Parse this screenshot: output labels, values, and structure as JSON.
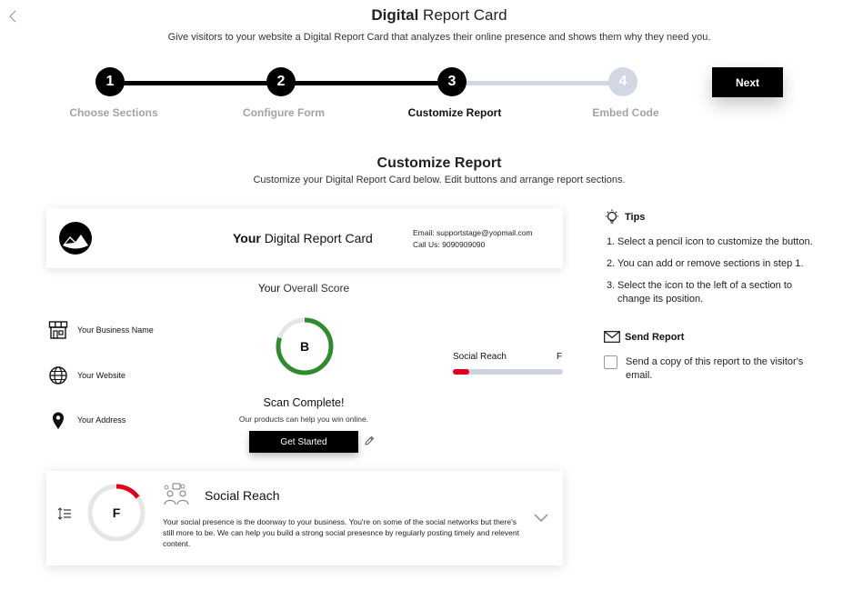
{
  "header": {
    "back_icon": "chevron-left-icon",
    "title_bold": "Digital",
    "title_rest": " Report Card",
    "subtitle": "Give visitors to your website a Digital Report Card that analyzes their online presence and shows them why they need you."
  },
  "stepper": {
    "steps": [
      {
        "number": "1",
        "label": "Choose Sections",
        "state": "done"
      },
      {
        "number": "2",
        "label": "Configure Form",
        "state": "done"
      },
      {
        "number": "3",
        "label": "Customize Report",
        "state": "active"
      },
      {
        "number": "4",
        "label": "Embed Code",
        "state": "pending"
      }
    ],
    "next_label": "Next"
  },
  "section": {
    "title": "Customize Report",
    "subtitle": "Customize your Digital Report Card below. Edit buttons and arrange report sections."
  },
  "report": {
    "title_bold": "Your",
    "title_rest": " Digital Report Card",
    "email": "Email: supportstage@yopmail.com",
    "phone": "Call Us: 9090909090",
    "overall_bold": "Your",
    "overall_rest": " Overall Score",
    "business": [
      {
        "icon": "storefront-icon",
        "label": "Your Business Name"
      },
      {
        "icon": "globe-icon",
        "label": "Your Website"
      },
      {
        "icon": "location-pin-icon",
        "label": "Your Address"
      }
    ],
    "overall_grade": "B",
    "overall_progress": 0.8,
    "scan_title": "Scan Complete!",
    "scan_sub": "Our products can help you win online.",
    "cta_label": "Get Started",
    "metric": {
      "label": "Social Reach",
      "grade": "F",
      "progress": 0.15
    }
  },
  "social_section": {
    "grade": "F",
    "progress": 0.15,
    "title": "Social Reach",
    "description": "Your social presence is the doorway to your business. You're on some of the social networks but there's still more to be. We can help you build a strong social presesnce by regularly posting timely and relevent content."
  },
  "tips": {
    "title": "Tips",
    "items": [
      {
        "num": "1.",
        "text": "Select a pencil icon to customize the button."
      },
      {
        "num": "2.",
        "text": "You can add or remove sections in step 1."
      },
      {
        "num": "3.",
        "text": "Select the icon to the left of a section to change its position."
      }
    ]
  },
  "send_report": {
    "title": "Send Report",
    "checkbox_label": "Send a copy of this report to the visitor's email.",
    "checked": false
  },
  "colors": {
    "done": "#000000",
    "pending": "#d3d6e3",
    "pending_label": "#9a9a9a",
    "grade_good": "#2e8b2e",
    "grade_bad": "#e0001b",
    "ring_track": "#e6e6e6"
  }
}
